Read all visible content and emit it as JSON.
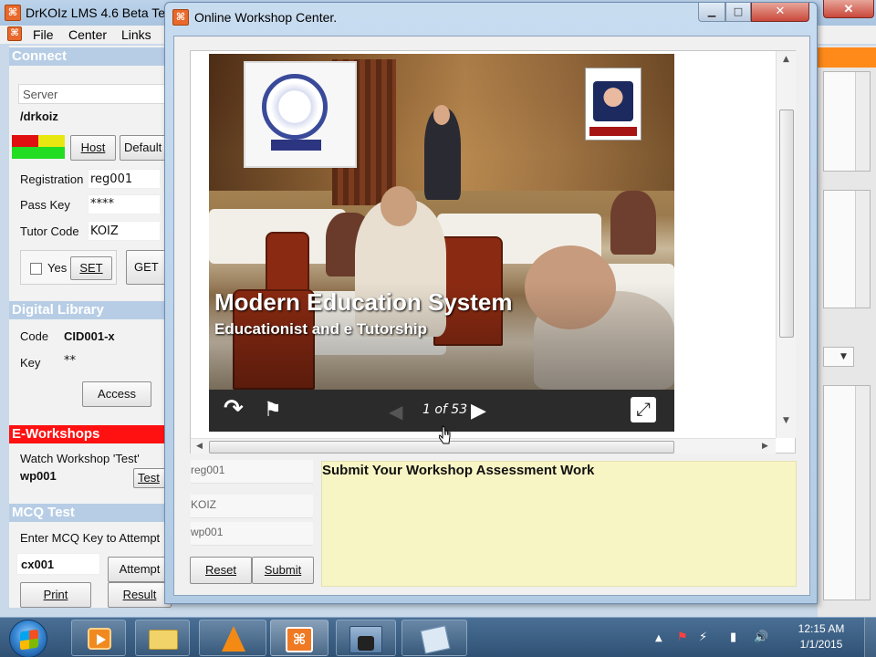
{
  "main_window": {
    "title": "DrKOIz LMS 4.6 Beta Te",
    "app_icon": "⌘",
    "menu": [
      "File",
      "Center",
      "Links"
    ],
    "close_icon": "✕"
  },
  "left_panel": {
    "connect": {
      "header": "Connect",
      "server_value": "Server",
      "path": "/drkoiz",
      "host_button": "Host",
      "default_button": "Default",
      "registration_label": "Registration",
      "registration_value": "reg001",
      "passkey_label": "Pass Key",
      "passkey_value": "****",
      "tutor_code_label": "Tutor Code",
      "tutor_code_value": "KOIZ",
      "yes_label": "Yes",
      "set_button": "SET",
      "get_button": "GET"
    },
    "digital_library": {
      "header": "Digital Library",
      "code_label": "Code",
      "code_value": "CID001-x",
      "key_label": "Key",
      "key_value": "**",
      "access_button": "Access"
    },
    "e_workshops": {
      "header": "E-Workshops",
      "watch_label": "Watch Workshop  'Test'",
      "workshop_value": "wp001",
      "test_button": "Test"
    },
    "mcq_test": {
      "header": "MCQ Test",
      "enter_label": "Enter MCQ Key to Attempt",
      "key_value": "cx001",
      "attempt_button": "Attempt",
      "print_button": "Print",
      "result_button": "Result"
    }
  },
  "dialog": {
    "title": "Online Workshop Center.",
    "app_icon": "⌘",
    "minimize_icon": "▁",
    "maximize_icon": "□",
    "close_icon": "✕",
    "slide": {
      "title": "Modern Education System",
      "subtitle": "Educationist and e Tutorship"
    },
    "player": {
      "counter": "1 of 53",
      "share_icon": "↷",
      "flag_icon": "⚑",
      "prev_icon": "◀",
      "next_icon": "▶",
      "fullscreen_icon": "⤢"
    },
    "form": {
      "registration_value": "reg001",
      "tutor_value": "KOIZ",
      "workshop_value": "wp001",
      "reset_button": "Reset",
      "submit_button": "Submit",
      "assessment_title": "Submit Your Workshop Assessment Work"
    }
  },
  "taskbar": {
    "clock_time": "12:15 AM",
    "clock_date": "1/1/2015",
    "tray_up_icon": "▲",
    "tray_flag_icon": "⚑",
    "tray_power_icon": "⚡",
    "tray_signal_icon": "▮",
    "tray_volume_icon": "🔊"
  },
  "colors": {
    "section_header": "#b7cde5",
    "e_workshops_header": "#ff1111",
    "assessment_bg": "#f8f5c5",
    "player_bar": "#2b2b2b"
  }
}
